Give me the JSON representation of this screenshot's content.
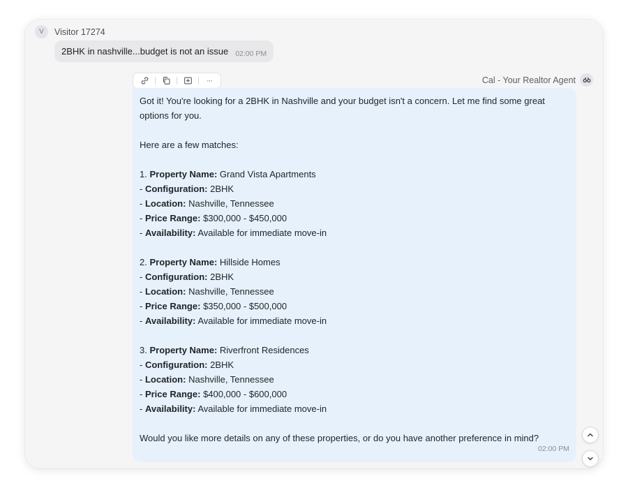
{
  "visitor": {
    "avatar_letter": "V",
    "name": "Visitor 17274",
    "message": "2BHK in nashville...budget is not an issue",
    "time": "02:00 PM"
  },
  "toolbar": {
    "icons": [
      "link-icon",
      "copy-icon",
      "add-note-icon",
      "more-icon"
    ],
    "more_label": "···"
  },
  "agent": {
    "name": "Cal - Your Realtor Agent",
    "intro": "Got it! You're looking for a 2BHK in Nashville and your budget isn't a concern. Let me find some great options for you.",
    "matches_heading": "Here are a few matches:",
    "properties": [
      {
        "number": "1.",
        "name": "Grand Vista Apartments",
        "configuration": "2BHK",
        "location": "Nashville, Tennessee",
        "price_range": "$300,000 - $450,000",
        "availability": "Available for immediate move-in"
      },
      {
        "number": "2.",
        "name": "Hillside Homes",
        "configuration": "2BHK",
        "location": "Nashville, Tennessee",
        "price_range": "$350,000 - $500,000",
        "availability": "Available for immediate move-in"
      },
      {
        "number": "3.",
        "name": "Riverfront Residences",
        "configuration": "2BHK",
        "location": "Nashville, Tennessee",
        "price_range": "$400,000 - $600,000",
        "availability": "Available for immediate move-in"
      }
    ],
    "field_labels": {
      "name": "Property Name:",
      "configuration": "Configuration:",
      "location": "Location:",
      "price_range": "Price Range:",
      "availability": "Availability:"
    },
    "closing": "Would you like more details on any of these properties, or do you have another preference in mind?",
    "time": "02:00 PM"
  },
  "colors": {
    "agent_bubble": "#e7f1fb",
    "user_bubble": "#e8e8eb",
    "panel": "#f5f5f6"
  }
}
